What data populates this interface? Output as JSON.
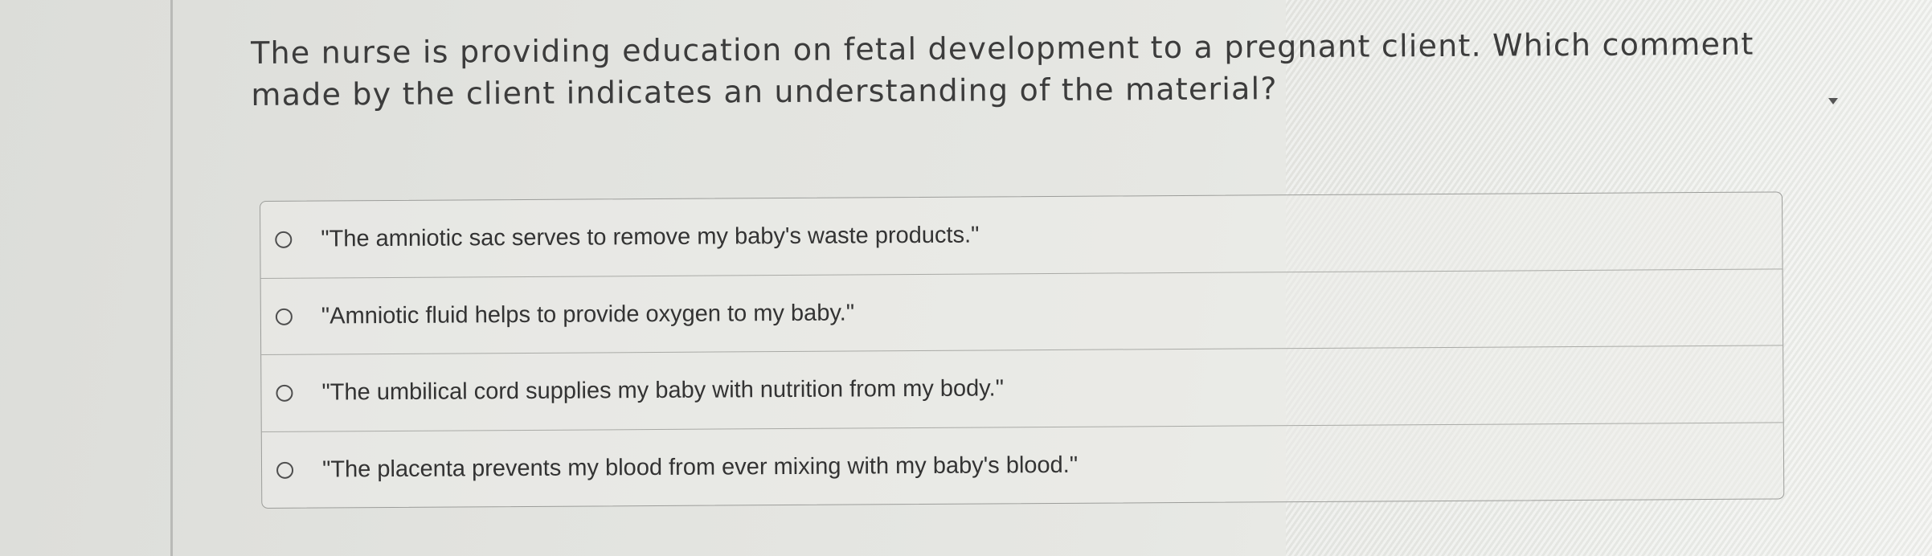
{
  "question": {
    "text": "The nurse is providing education on fetal development to a pregnant client. Which comment made by the client indicates an understanding of the material?"
  },
  "options": [
    {
      "label": "\"The amniotic sac serves to remove my baby's waste products.\"",
      "selected": false
    },
    {
      "label": "\"Amniotic fluid helps to provide oxygen to my baby.\"",
      "selected": false
    },
    {
      "label": "\"The umbilical cord supplies my baby with nutrition from my body.\"",
      "selected": false
    },
    {
      "label": "\"The placenta prevents my blood from ever mixing with my baby's blood.\"",
      "selected": false
    }
  ],
  "colors": {
    "background": "#e2e3df",
    "text": "#3c3c3c",
    "border": "#9c9d9a"
  },
  "icons": {
    "scroll": "caret-down-icon",
    "radio": "radio-unchecked-icon"
  }
}
